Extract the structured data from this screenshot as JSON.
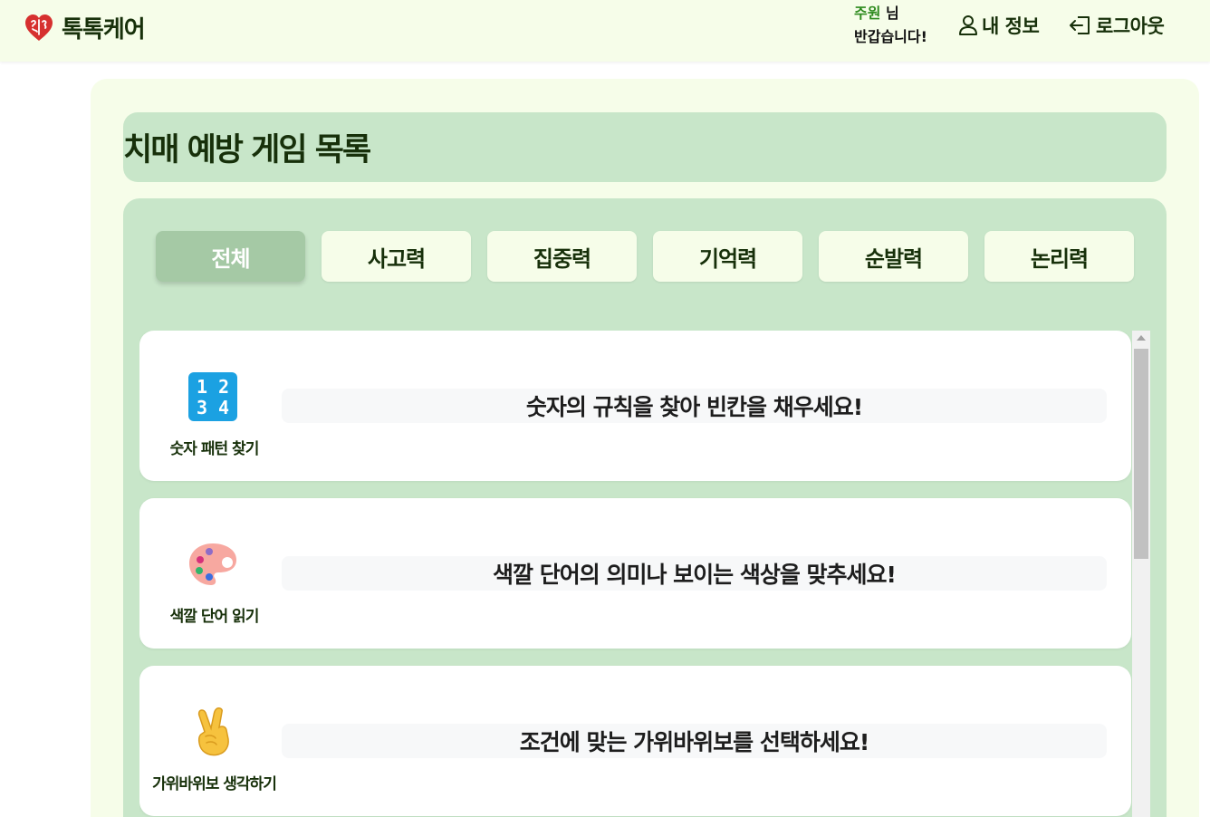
{
  "header": {
    "brand_name": "톡톡케어",
    "brand_icon": "heart-brain-icon",
    "greeting_user": "주원",
    "greeting_suffix": " 님",
    "greeting_line2": "반갑습니다!",
    "my_info_label": "내 정보",
    "my_info_icon": "user-icon",
    "logout_label": "로그아웃",
    "logout_icon": "logout-icon"
  },
  "page": {
    "title": "치매 예방 게임 목록"
  },
  "tabs": [
    {
      "label": "전체",
      "active": true
    },
    {
      "label": "사고력",
      "active": false
    },
    {
      "label": "집중력",
      "active": false
    },
    {
      "label": "기억력",
      "active": false
    },
    {
      "label": "순발력",
      "active": false
    },
    {
      "label": "논리력",
      "active": false
    }
  ],
  "games": [
    {
      "name": "숫자 패턴 찾기",
      "description": "숫자의 규칙을 찾아 빈칸을 채우세요!",
      "icon": "numbers-1234-icon"
    },
    {
      "name": "색깔 단어 읽기",
      "description": "색깔 단어의 의미나 보이는 색상을 맞추세요!",
      "icon": "artist-palette-icon"
    },
    {
      "name": "가위바위보 생각하기",
      "description": "조건에 맞는 가위바위보를 선택하세요!",
      "icon": "victory-hand-icon"
    }
  ],
  "icon_glyphs": {
    "numbers_row1": "1 2",
    "numbers_row2": "3 4"
  },
  "colors": {
    "header_bg": "#f6fde9",
    "panel_bg": "#f6fde9",
    "section_bg": "#c8e6c9",
    "active_tab_bg": "#a5c9a5",
    "username": "#2e8b1e",
    "text_dark": "#17300a"
  }
}
